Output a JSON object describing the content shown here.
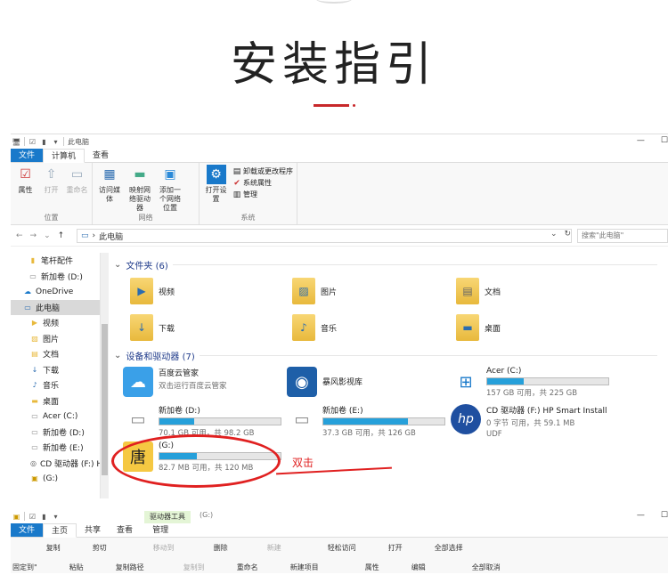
{
  "page": {
    "title": "安装指引"
  },
  "window": {
    "qat_title": "此电脑",
    "controls": [
      "—",
      "☐"
    ],
    "tabs": [
      "文件",
      "计算机",
      "查看"
    ],
    "ribbon": {
      "groups": [
        {
          "label": "位置",
          "buttons": [
            "属性",
            "打开",
            "重命名"
          ]
        },
        {
          "label": "网络",
          "buttons": [
            "访问媒体",
            "映射网络驱动器",
            "添加一个网络位置"
          ]
        },
        {
          "label": "系统",
          "buttons": [
            "打开设置"
          ],
          "small": [
            "卸载或更改程序",
            "系统属性",
            "管理"
          ]
        }
      ]
    },
    "address": {
      "path": "此电脑",
      "search_placeholder": "搜索\"此电脑\""
    },
    "nav": [
      {
        "label": "笔杆配件",
        "icon": "folder-icon"
      },
      {
        "label": "新加卷 (D:)",
        "icon": "drive-icon"
      },
      {
        "label": "OneDrive",
        "icon": "cloud-icon"
      },
      {
        "label": "此电脑",
        "icon": "computer-icon",
        "selected": true
      },
      {
        "label": "视频",
        "icon": "video-icon"
      },
      {
        "label": "图片",
        "icon": "picture-icon"
      },
      {
        "label": "文档",
        "icon": "document-icon"
      },
      {
        "label": "下载",
        "icon": "download-icon"
      },
      {
        "label": "音乐",
        "icon": "music-icon"
      },
      {
        "label": "桌面",
        "icon": "desktop-icon"
      },
      {
        "label": "Acer (C:)",
        "icon": "drive-icon"
      },
      {
        "label": "新加卷 (D:)",
        "icon": "drive-icon"
      },
      {
        "label": "新加卷 (E:)",
        "icon": "drive-icon"
      },
      {
        "label": "CD 驱动器 (F:) H",
        "icon": "cd-icon"
      },
      {
        "label": "(G:)",
        "icon": "usb-icon"
      }
    ],
    "folders_header": "文件夹 (6)",
    "folders": [
      "视频",
      "图片",
      "文档",
      "下载",
      "音乐",
      "桌面"
    ],
    "drives_header": "设备和驱动器 (7)",
    "drives": [
      {
        "name": "百度云管家",
        "sub": "双击运行百度云管家",
        "bar": false
      },
      {
        "name": "暴风影视库",
        "sub": "",
        "bar": false
      },
      {
        "name": "Acer (C:)",
        "sub": "157 GB 可用，共 225 GB",
        "bar": true,
        "used": 0.3
      },
      {
        "name": "新加卷 (D:)",
        "sub": "70.1 GB 可用，共 98.2 GB",
        "bar": true,
        "used": 0.29
      },
      {
        "name": "新加卷 (E:)",
        "sub": "37.3 GB 可用，共 126 GB",
        "bar": true,
        "used": 0.7
      },
      {
        "name": "CD 驱动器 (F:) HP Smart Install",
        "sub": "0 字节 可用，共 59.1 MB",
        "sub2": "UDF",
        "bar": false
      },
      {
        "name": "(G:)",
        "sub": "82.7 MB 可用，共 120 MB",
        "bar": true,
        "used": 0.31
      }
    ],
    "callout": "双击"
  },
  "window2": {
    "title": "(G:)",
    "context_tab": "驱动器工具",
    "tabs": [
      "文件",
      "主页",
      "共享",
      "查看",
      "管理"
    ],
    "ribbon_items": [
      "固定到\"",
      "复制",
      "粘贴",
      "剪切",
      "复制路径",
      "移动到",
      "复制到",
      "删除",
      "重命名",
      "新建",
      "新建项目",
      "轻松访问",
      "属性",
      "打开",
      "编辑",
      "全部选择",
      "全部取消"
    ]
  }
}
